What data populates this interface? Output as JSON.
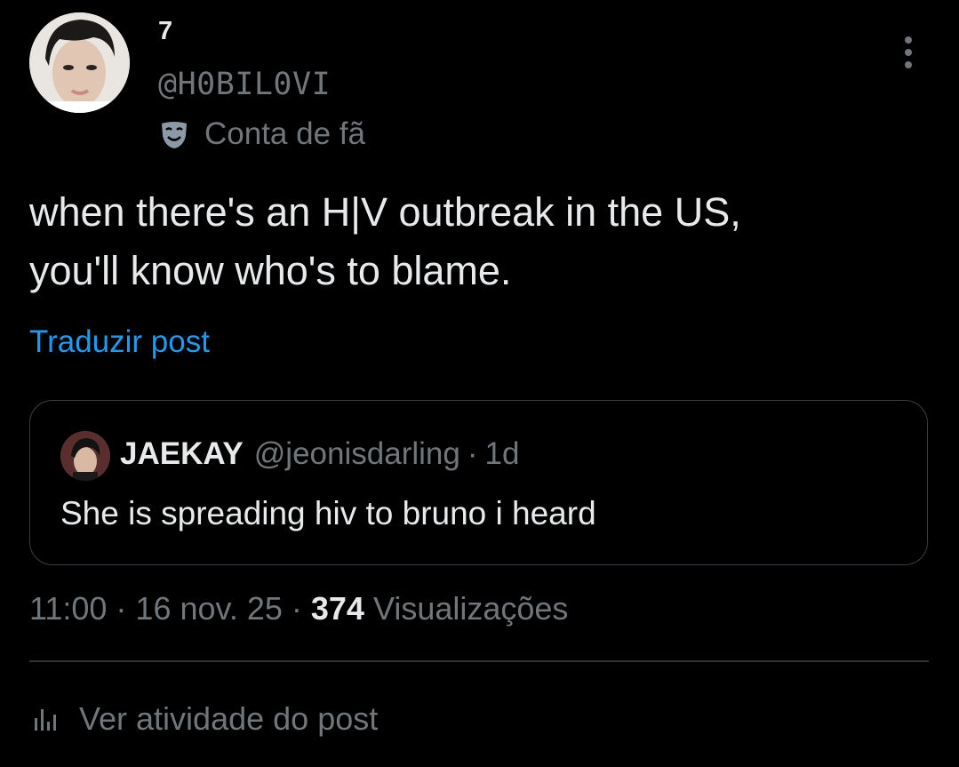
{
  "post": {
    "author": {
      "display_name": "7",
      "handle": "@H0BIL0VI",
      "badge_label": "Conta de fã",
      "badge_icon": "theater-mask-icon"
    },
    "text_lines": [
      "when there's an H|V outbreak in the US,",
      "you'll know who's to blame."
    ],
    "translate_label": "Traduzir post",
    "quote": {
      "name": "JAEKAY",
      "handle": "@jeonisdarling",
      "separator": "·",
      "time": "1d",
      "text": "She is spreading hiv to bruno i heard"
    },
    "meta": {
      "time": "11:00",
      "separator": "·",
      "date": "16 nov. 25",
      "views_count": "374",
      "views_label": "Visualizações"
    },
    "activity_label": "Ver atividade do post",
    "activity_icon": "bar-chart-icon"
  },
  "colors": {
    "background": "#000000",
    "primary_text": "#e7e9ea",
    "secondary_text": "#71767b",
    "link": "#1d9bf0",
    "border": "#2f3336"
  }
}
